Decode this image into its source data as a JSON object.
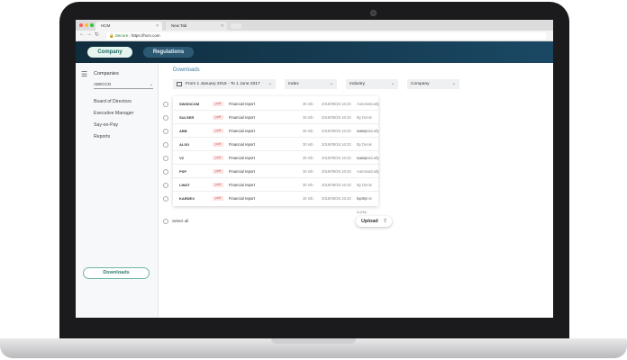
{
  "browser": {
    "tabs": [
      {
        "label": "HCM"
      },
      {
        "label": "New Tab"
      }
    ],
    "secure_label": "Secure",
    "url": "https://hcm.com"
  },
  "header": {
    "company_tab": "Company",
    "regulations_tab": "Regulations",
    "accent": "#1a4864"
  },
  "sidebar": {
    "title": "Companies",
    "selected_company": "ADECCO",
    "items": [
      "Board of Directors",
      "Executive Manager",
      "Say-on-Pay",
      "Reports"
    ],
    "downloads_button": "Downloads"
  },
  "main": {
    "title": "Downloads",
    "filters": {
      "date": "From 1 January 2016 - To 1 June 2017",
      "index": "Index",
      "industry": "Industry",
      "company": "Company"
    },
    "rows": [
      {
        "name": "SWISSCOM",
        "format": "pdf",
        "type": "Financial report",
        "size": "30 mb",
        "date": "2018/09/26 16:23",
        "by": "Automatically"
      },
      {
        "name": "SULSER",
        "format": "pdf",
        "type": "Financial report",
        "size": "30 mb",
        "date": "2018/09/26 16:23",
        "by": "By Denis Lucey"
      },
      {
        "name": "ABB",
        "format": "pdf",
        "type": "Financial report",
        "size": "30 mb",
        "date": "2018/09/26 16:23",
        "by": "Automatically"
      },
      {
        "name": "ALSO",
        "format": "pdf",
        "type": "Financial report",
        "size": "30 mb",
        "date": "2018/09/26 16:23",
        "by": "By Denis Lucey"
      },
      {
        "name": "VZ",
        "format": "pdf",
        "type": "Financial report",
        "size": "30 mb",
        "date": "2018/09/26 16:23",
        "by": "Automatically"
      },
      {
        "name": "PSP",
        "format": "pdf",
        "type": "Financial report",
        "size": "30 mb",
        "date": "2018/09/26 16:23",
        "by": "Automatically"
      },
      {
        "name": "LINDT",
        "format": "pdf",
        "type": "Financial report",
        "size": "30 mb",
        "date": "2018/09/26 16:23",
        "by": "By Denis Lucey"
      },
      {
        "name": "KARDEX",
        "format": "pdf",
        "type": "Financial report",
        "size": "30 mb",
        "date": "2018/09/26 16:23",
        "by": "By Denis Lucey"
      }
    ],
    "select_all": "Select all",
    "upload": "Upload"
  }
}
